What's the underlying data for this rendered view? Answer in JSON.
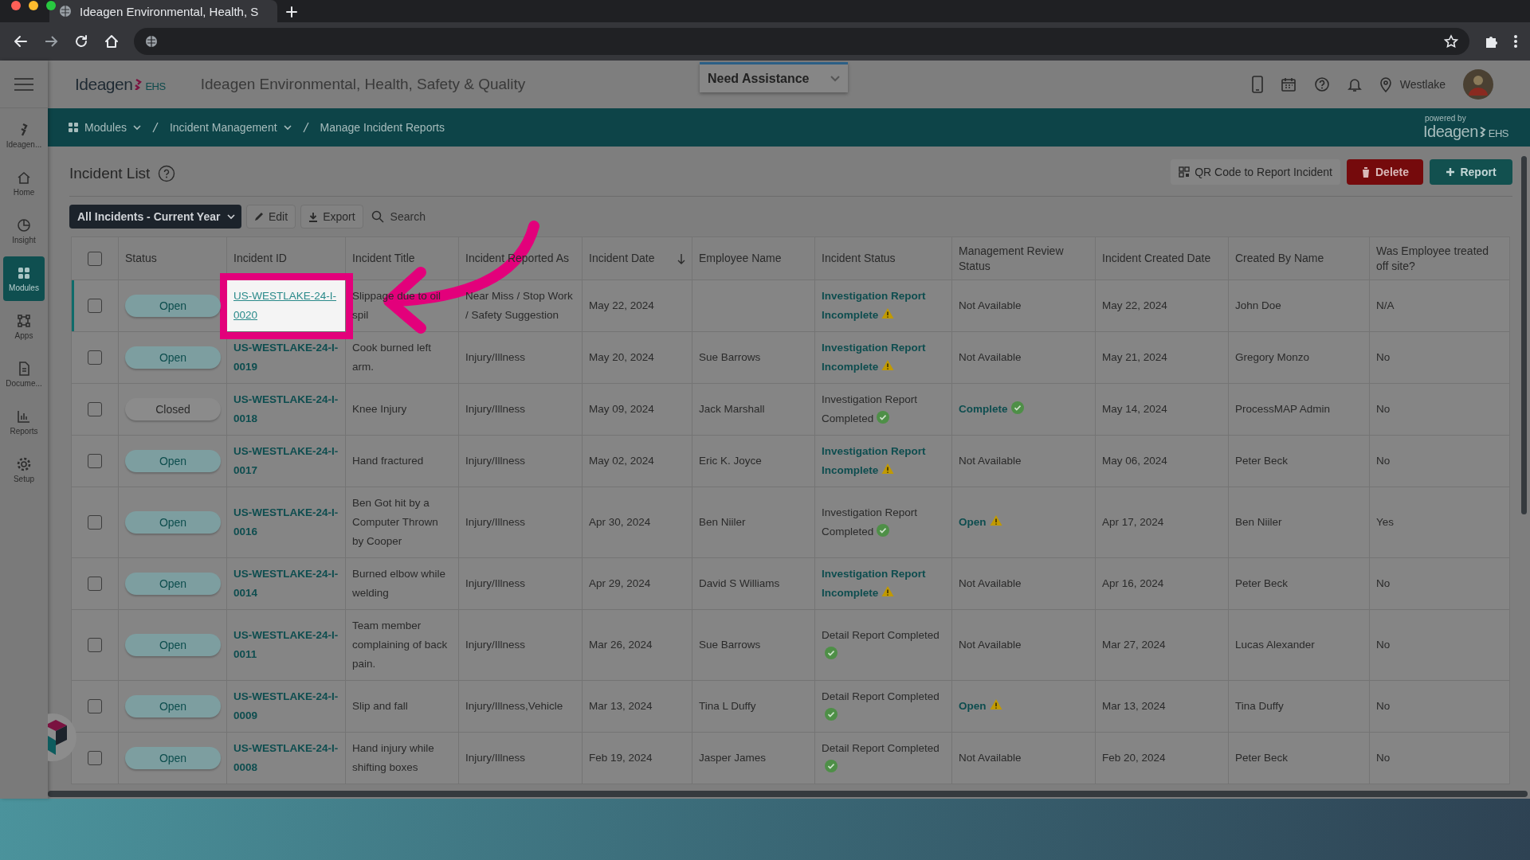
{
  "browser": {
    "tab_title": "Ideagen Environmental, Health, S"
  },
  "header": {
    "logo": "Ideagen",
    "logo_suffix": "EHS",
    "app_title": "Ideagen Environmental, Health, Safety & Quality",
    "assistance": "Need Assistance",
    "location": "Westlake"
  },
  "sidebar": {
    "items": [
      {
        "label": "Ideagen...",
        "selected": false
      },
      {
        "label": "Home",
        "selected": false
      },
      {
        "label": "Insight",
        "selected": false
      },
      {
        "label": "Modules",
        "selected": true
      },
      {
        "label": "Apps",
        "selected": false
      },
      {
        "label": "Docume...",
        "selected": false
      },
      {
        "label": "Reports",
        "selected": false
      },
      {
        "label": "Setup",
        "selected": false
      }
    ]
  },
  "breadcrumb": {
    "items": [
      {
        "label": "Modules",
        "dropdown": true
      },
      {
        "label": "Incident Management",
        "dropdown": true
      },
      {
        "label": "Manage Incident Reports",
        "dropdown": false
      }
    ],
    "powered_by": "powered by",
    "brand": "Ideagen",
    "brand_suffix": "EHS"
  },
  "toolbar": {
    "title": "Incident List",
    "qr_button": "QR Code to Report Incident",
    "delete_button": "Delete",
    "report_button": "Report",
    "filter": "All Incidents - Current Year",
    "edit_button": "Edit",
    "export_button": "Export",
    "search_placeholder": "Search"
  },
  "table": {
    "select_all": {
      "checked": false
    },
    "columns": [
      {
        "label": "Status",
        "sorted": false
      },
      {
        "label": "Incident ID",
        "sorted": false
      },
      {
        "label": "Incident Title",
        "sorted": false
      },
      {
        "label": "Incident Reported As",
        "sorted": false
      },
      {
        "label": "Incident Date",
        "sorted": true
      },
      {
        "label": "Employee Name",
        "sorted": false
      },
      {
        "label": "Incident Status",
        "sorted": false
      },
      {
        "label": "Management Review Status",
        "sorted": false
      },
      {
        "label": "Incident Created Date",
        "sorted": false
      },
      {
        "label": "Created By Name",
        "sorted": false
      },
      {
        "label": "Was Employee treated off site?",
        "sorted": false
      }
    ],
    "rows": [
      {
        "checked": false,
        "highlighted": true,
        "status": {
          "label": "Open",
          "kind": "open"
        },
        "id": "US-WESTLAKE-24-I-0020",
        "title": "Slippage due to oil spil",
        "reported_as": "Near Miss / Stop Work / Safety Suggestion",
        "date": "May 22, 2024",
        "employee": "",
        "incident_status": {
          "label": "Investigation Report Incomplete",
          "kind": "incomplete"
        },
        "review": {
          "label": "Not Available",
          "kind": "none"
        },
        "created": "May 22, 2024",
        "created_by": "John Doe",
        "treated": "N/A"
      },
      {
        "checked": false,
        "highlighted": false,
        "status": {
          "label": "Open",
          "kind": "open"
        },
        "id": "US-WESTLAKE-24-I-0019",
        "title": "Cook burned left arm.",
        "reported_as": "Injury/Illness",
        "date": "May 20, 2024",
        "employee": "Sue Barrows",
        "incident_status": {
          "label": "Investigation Report Incomplete",
          "kind": "incomplete"
        },
        "review": {
          "label": "Not Available",
          "kind": "none"
        },
        "created": "May 21, 2024",
        "created_by": "Gregory Monzo",
        "treated": "No"
      },
      {
        "checked": false,
        "highlighted": false,
        "status": {
          "label": "Closed",
          "kind": "closed"
        },
        "id": "US-WESTLAKE-24-I-0018",
        "title": "Knee Injury",
        "reported_as": "Injury/Illness",
        "date": "May 09, 2024",
        "employee": "Jack Marshall",
        "incident_status": {
          "label": "Investigation Report Completed",
          "kind": "completed"
        },
        "review": {
          "label": "Complete",
          "kind": "complete"
        },
        "created": "May 14, 2024",
        "created_by": "ProcessMAP Admin",
        "treated": "No"
      },
      {
        "checked": false,
        "highlighted": false,
        "status": {
          "label": "Open",
          "kind": "open"
        },
        "id": "US-WESTLAKE-24-I-0017",
        "title": "Hand fractured",
        "reported_as": "Injury/Illness",
        "date": "May 02, 2024",
        "employee": "Eric K. Joyce",
        "incident_status": {
          "label": "Investigation Report Incomplete",
          "kind": "incomplete"
        },
        "review": {
          "label": "Not Available",
          "kind": "none"
        },
        "created": "May 06, 2024",
        "created_by": "Peter Beck",
        "treated": "No"
      },
      {
        "checked": false,
        "highlighted": false,
        "status": {
          "label": "Open",
          "kind": "open"
        },
        "id": "US-WESTLAKE-24-I-0016",
        "title": "Ben Got hit by a Computer Thrown by Cooper",
        "reported_as": "Injury/Illness",
        "date": "Apr 30, 2024",
        "employee": "Ben Niiler",
        "incident_status": {
          "label": "Investigation Report Completed",
          "kind": "completed"
        },
        "review": {
          "label": "Open",
          "kind": "open"
        },
        "created": "Apr 17, 2024",
        "created_by": "Ben Niiler",
        "treated": "Yes"
      },
      {
        "checked": false,
        "highlighted": false,
        "status": {
          "label": "Open",
          "kind": "open"
        },
        "id": "US-WESTLAKE-24-I-0014",
        "title": "Burned elbow while welding",
        "reported_as": "Injury/Illness",
        "date": "Apr 29, 2024",
        "employee": "David S Williams",
        "incident_status": {
          "label": "Investigation Report Incomplete",
          "kind": "incomplete"
        },
        "review": {
          "label": "Not Available",
          "kind": "none"
        },
        "created": "Apr 16, 2024",
        "created_by": "Peter Beck",
        "treated": "No"
      },
      {
        "checked": false,
        "highlighted": false,
        "status": {
          "label": "Open",
          "kind": "open"
        },
        "id": "US-WESTLAKE-24-I-0011",
        "title": "Team member complaining of back pain.",
        "reported_as": "Injury/Illness",
        "date": "Mar 26, 2024",
        "employee": "Sue Barrows",
        "incident_status": {
          "label": "Detail Report Completed",
          "kind": "completed"
        },
        "review": {
          "label": "Not Available",
          "kind": "none"
        },
        "created": "Mar 27, 2024",
        "created_by": "Lucas Alexander",
        "treated": "No"
      },
      {
        "checked": false,
        "highlighted": false,
        "status": {
          "label": "Open",
          "kind": "open"
        },
        "id": "US-WESTLAKE-24-I-0009",
        "title": "Slip and fall",
        "reported_as": "Injury/Illness,Vehicle",
        "date": "Mar 13, 2024",
        "employee": "Tina L Duffy",
        "incident_status": {
          "label": "Detail Report Completed",
          "kind": "completed"
        },
        "review": {
          "label": "Open",
          "kind": "open"
        },
        "created": "Mar 13, 2024",
        "created_by": "Tina Duffy",
        "treated": "No"
      },
      {
        "checked": false,
        "highlighted": false,
        "status": {
          "label": "Open",
          "kind": "open"
        },
        "id": "US-WESTLAKE-24-I-0008",
        "title": "Hand injury while shifting boxes",
        "reported_as": "Injury/Illness",
        "date": "Feb 19, 2024",
        "employee": "Jasper James",
        "incident_status": {
          "label": "Detail Report Completed",
          "kind": "completed"
        },
        "review": {
          "label": "Not Available",
          "kind": "none"
        },
        "created": "Feb 20, 2024",
        "created_by": "Peter Beck",
        "treated": "No"
      }
    ]
  }
}
